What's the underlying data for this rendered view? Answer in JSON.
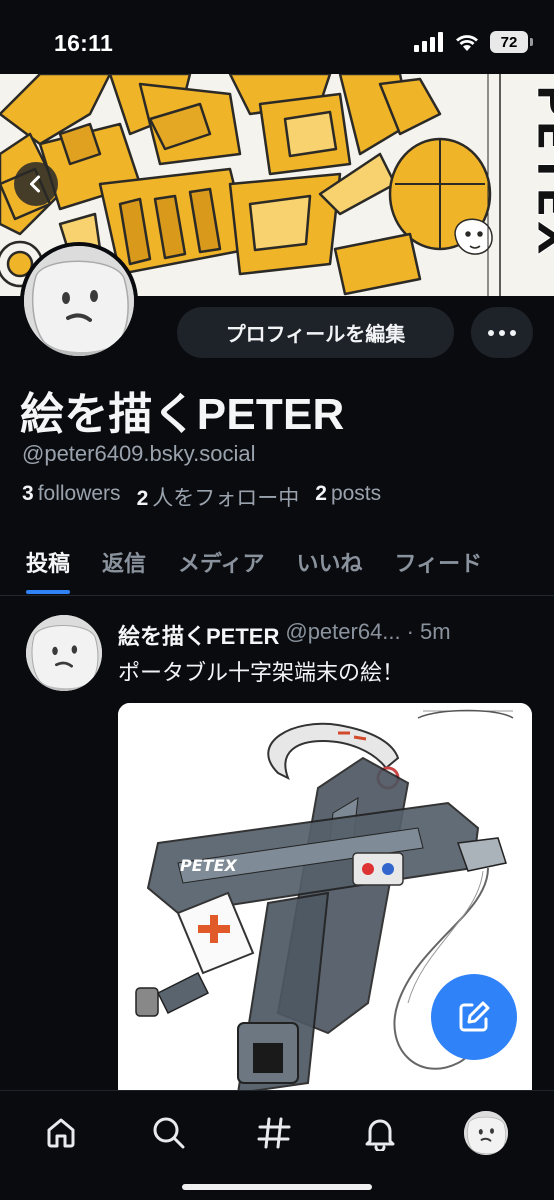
{
  "status_bar": {
    "time": "16:11",
    "battery": "72"
  },
  "banner": {
    "vertical_title": "PETEX",
    "accent": "#f0b429"
  },
  "profile": {
    "display_name": "絵を描くPETER",
    "handle": "@peter6409.bsky.social",
    "edit_button_label": "プロフィールを編集",
    "stats": {
      "followers_count": "3",
      "followers_label": "followers",
      "following_count": "2",
      "following_label": "人をフォロー中",
      "posts_count": "2",
      "posts_label": "posts"
    }
  },
  "tabs": [
    {
      "label": "投稿",
      "active": true
    },
    {
      "label": "返信"
    },
    {
      "label": "メディア"
    },
    {
      "label": "いいね"
    },
    {
      "label": "フィード"
    }
  ],
  "post": {
    "author": "絵を描くPETER",
    "handle": "@peter64...",
    "separator": "·",
    "time": "5m",
    "text": "ポータブル十字架端末の絵！",
    "image_brand": "PETEX"
  },
  "nav": {
    "items": [
      "home-icon",
      "search-icon",
      "feeds-icon",
      "notifications-icon",
      "profile-avatar"
    ]
  },
  "colors": {
    "background": "#0a0b0f",
    "accent_blue": "#2f82f7",
    "muted_text": "#8a939d"
  }
}
